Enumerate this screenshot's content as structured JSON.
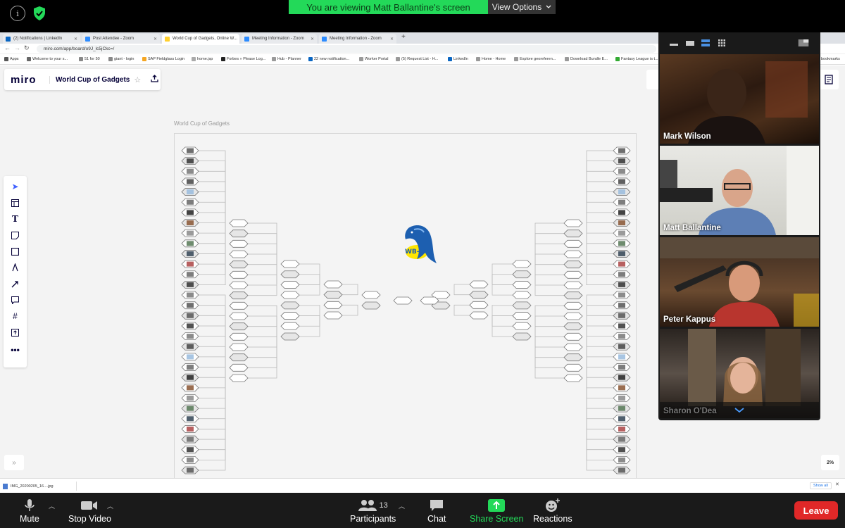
{
  "zoom": {
    "viewing_banner": "You are viewing Matt Ballantine's screen",
    "view_options": "View Options",
    "bottom_bar": {
      "mute": "Mute",
      "stop_video": "Stop Video",
      "participants": "Participants",
      "participants_count": "13",
      "chat": "Chat",
      "share_screen": "Share Screen",
      "reactions": "Reactions",
      "leave": "Leave"
    },
    "video_tiles": [
      {
        "name": "Mark Wilson"
      },
      {
        "name": "Matt Ballantine"
      },
      {
        "name": "Peter Kappus"
      },
      {
        "name": "Sharon O'Dea"
      }
    ]
  },
  "browser": {
    "tabs": [
      {
        "label": "(2) Notifications | LinkedIn",
        "color": "#0a66c2"
      },
      {
        "label": "Post Attendee - Zoom",
        "color": "#2d8cff"
      },
      {
        "label": "World Cup of Gadgets, Online W...",
        "color": "#ffd02f"
      },
      {
        "label": "Meeting Information - Zoom",
        "color": "#2d8cff"
      },
      {
        "label": "Meeting Information - Zoom",
        "color": "#2d8cff"
      }
    ],
    "url": "miro.com/app/board/o9J_lc5jCkc=/",
    "bookmarks": [
      "Apps",
      "Welcome to your s...",
      "51 for 50",
      "giant - login",
      "SAP Fieldglass Login",
      "home.jsp",
      "Forbes » Please Log...",
      "Hub - Planner",
      "22 new notification...",
      "Worker Portal",
      "(5) Request List - H...",
      "LinkedIn",
      "Home - Home",
      "Explore georeferen...",
      "Download Bundle E...",
      "Fantasy League is t...",
      "bookmarks"
    ],
    "downloads": {
      "file": "IMG_20200205_16....jpg",
      "show_all": "Show all"
    }
  },
  "miro": {
    "logo": "miro",
    "board_title": "World Cup of Gadgets",
    "frame_label": "World Cup of Gadgets",
    "zoom_level": "2%",
    "collapse": "»",
    "emblem_text": "WB-40",
    "accent": "#050038"
  }
}
